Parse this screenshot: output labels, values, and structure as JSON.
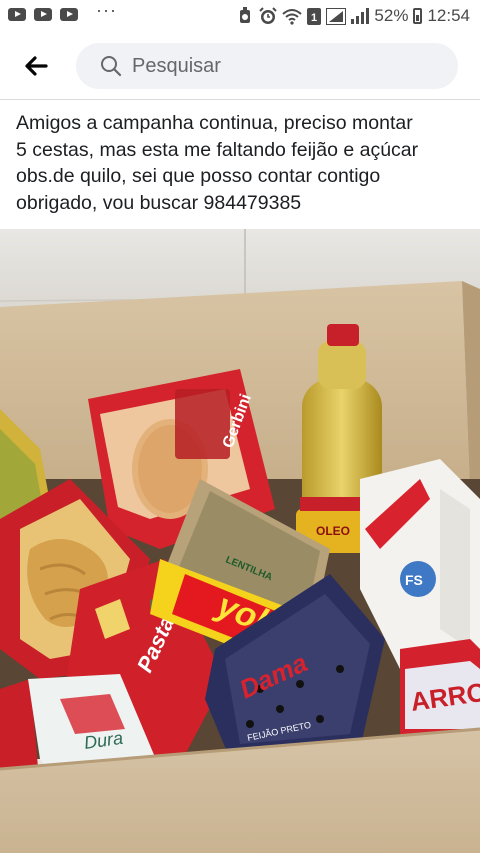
{
  "status_bar": {
    "more": "···",
    "battery": "52%",
    "time": "12:54"
  },
  "search": {
    "placeholder": "Pesquisar"
  },
  "post": {
    "lines": [
      "Amigos a campanha continua, preciso montar",
      "5 cestas, mas esta me faltando feijão e açúcar",
      "obs.de quilo, sei que posso contar contigo",
      "obrigado, vou buscar 984479385"
    ]
  },
  "photo": {
    "labels": {
      "biscuit": "Gerbini",
      "yoki": "yoki",
      "yoki_top": "LENTILHA",
      "pasta": "Pasta Mahí",
      "rice": "ARROZ",
      "sugar": "FS",
      "beans": "Dama",
      "beans_small": "FEIJÃO PRETO",
      "oil_tag": "OLEO",
      "bottom_left": "Dura"
    }
  }
}
